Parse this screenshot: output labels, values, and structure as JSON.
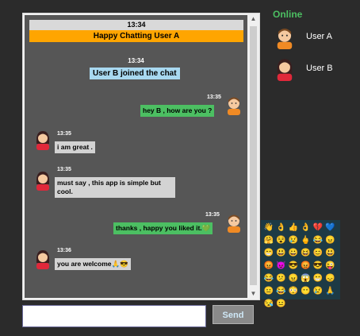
{
  "header": {
    "time": "13:34",
    "greeting": "Happy Chatting User A"
  },
  "system": {
    "time": "13:34",
    "join_text": "User B joined the chat"
  },
  "messages": [
    {
      "from": "me",
      "time": "13:35",
      "text": "hey B , how are you ?"
    },
    {
      "from": "them",
      "time": "13:35",
      "text": "i am great ."
    },
    {
      "from": "them",
      "time": "13:35",
      "text_line1": "must say , this app is simple but",
      "text_line2": "cool."
    },
    {
      "from": "me",
      "time": "13:35",
      "text": "thanks , happy you liked it."
    },
    {
      "from": "them",
      "time": "13:36",
      "text": "you are welcome"
    }
  ],
  "sidebar": {
    "title": "Online",
    "users": [
      {
        "name": "User A",
        "avatar": "male-avatar-icon"
      },
      {
        "name": "User B",
        "avatar": "female-avatar-icon"
      }
    ]
  },
  "emoji_panel": {
    "emojis": [
      "👋",
      "👌",
      "👍",
      "👌",
      "💔",
      "💙",
      "🤗",
      "😵",
      "😢",
      "🖕",
      "😂",
      "😠",
      "😁",
      "😃",
      "😀",
      "😆",
      "😊",
      "😃",
      "😡",
      "😈",
      "😎",
      "😡",
      "😎",
      "😜",
      "😂",
      "😕",
      "😠",
      "😱",
      "😁",
      "😞",
      "😐",
      "😂",
      "😳",
      "😶",
      "😢",
      "🙏",
      "😪",
      "😐"
    ]
  },
  "composer": {
    "input_value": "",
    "placeholder": "",
    "send_label": "Send"
  },
  "colors": {
    "accent_green": "#4cbf62",
    "header_orange": "#ffa500",
    "chat_bg": "#565656",
    "page_bg": "#2b2b2b"
  }
}
